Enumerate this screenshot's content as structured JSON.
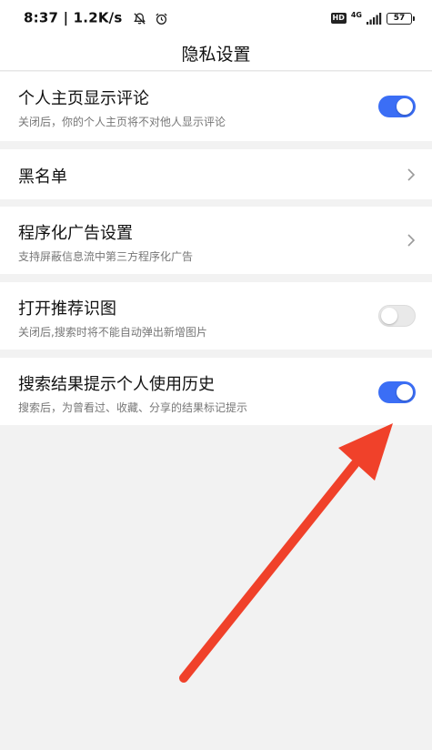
{
  "status_bar": {
    "time": "8:37",
    "net_speed": "1.2K/s",
    "hd": "HD",
    "network": "4G",
    "battery": "57"
  },
  "nav": {
    "title": "隐私设置"
  },
  "settings": [
    {
      "title": "个人主页显示评论",
      "desc": "关闭后，你的个人主页将不对他人显示评论",
      "control": "toggle",
      "enabled": true
    },
    {
      "title": "黑名单",
      "control": "chevron"
    },
    {
      "title": "程序化广告设置",
      "desc": "支持屏蔽信息流中第三方程序化广告",
      "control": "chevron"
    },
    {
      "title": "打开推荐识图",
      "desc": "关闭后,搜索时将不能自动弹出新增图片",
      "control": "toggle",
      "enabled": false
    },
    {
      "title": "搜索结果提示个人使用历史",
      "desc": "搜索后，为曾看过、收藏、分享的结果标记提示",
      "control": "toggle",
      "enabled": true
    }
  ],
  "colors": {
    "toggle_on": "#3b6ef5",
    "annotation_arrow": "#f0412a"
  },
  "icons": {
    "mute": "bell-slash-icon",
    "alarm": "alarm-icon",
    "signal": "signal-bars-icon",
    "battery": "battery-icon",
    "chevron": "chevron-right-icon",
    "arrow": "red-annotation-arrow-icon"
  }
}
